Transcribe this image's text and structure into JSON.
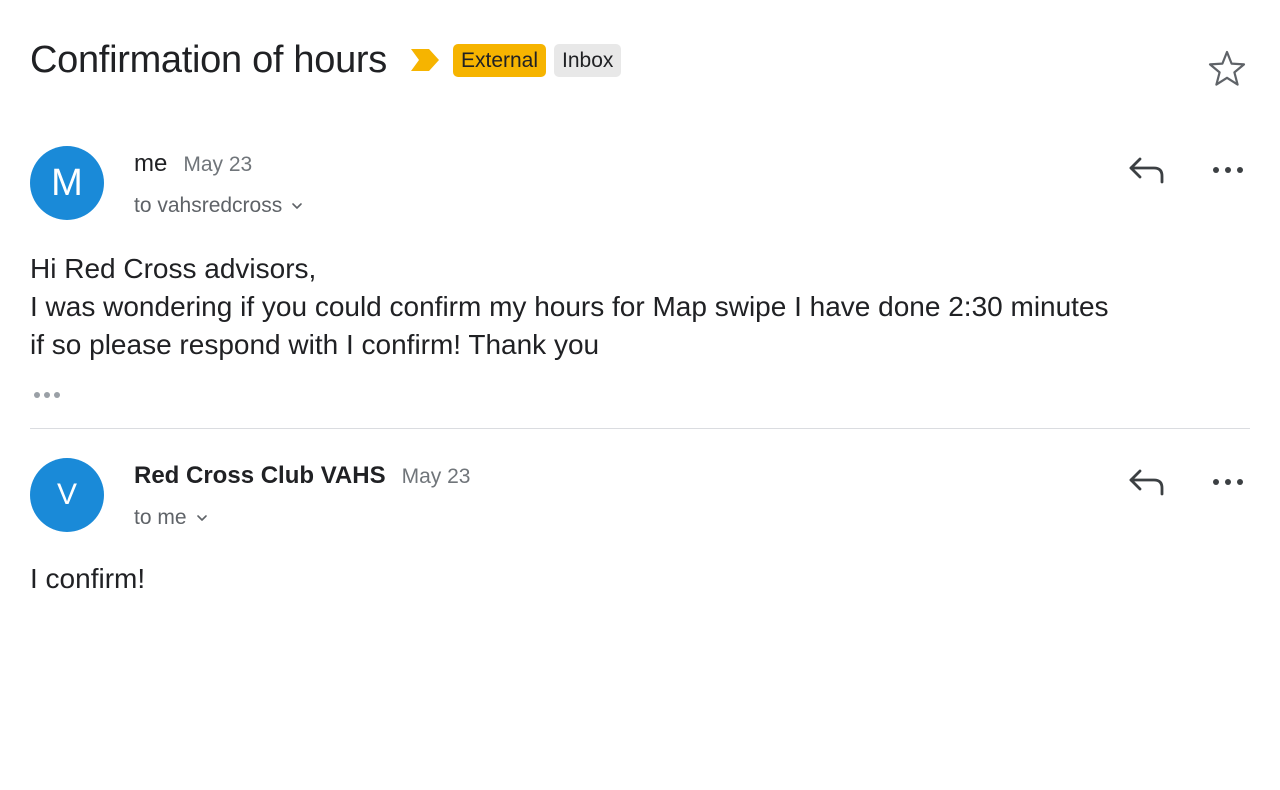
{
  "thread": {
    "subject": "Confirmation of hours",
    "labels": {
      "external": "External",
      "inbox": "Inbox"
    },
    "importance_color": "#f6b400",
    "star_icon": "star-outline-icon"
  },
  "messages": [
    {
      "avatar_letter": "M",
      "avatar_color": "#1a8ad8",
      "sender": "me",
      "date": "May 23",
      "recipient": "to vahsredcross",
      "body": [
        "Hi Red Cross advisors,",
        "I was wondering if you could confirm my hours for Map swipe I have done 2:30 minutes",
        "if so please respond with I confirm! Thank you"
      ],
      "has_quoted_text": true
    },
    {
      "avatar_letter": "V",
      "avatar_color": "#1a8ad8",
      "sender": "Red Cross Club VAHS",
      "date": "May 23",
      "recipient": "to me",
      "body": [
        "I confirm!"
      ],
      "has_quoted_text": false
    }
  ]
}
